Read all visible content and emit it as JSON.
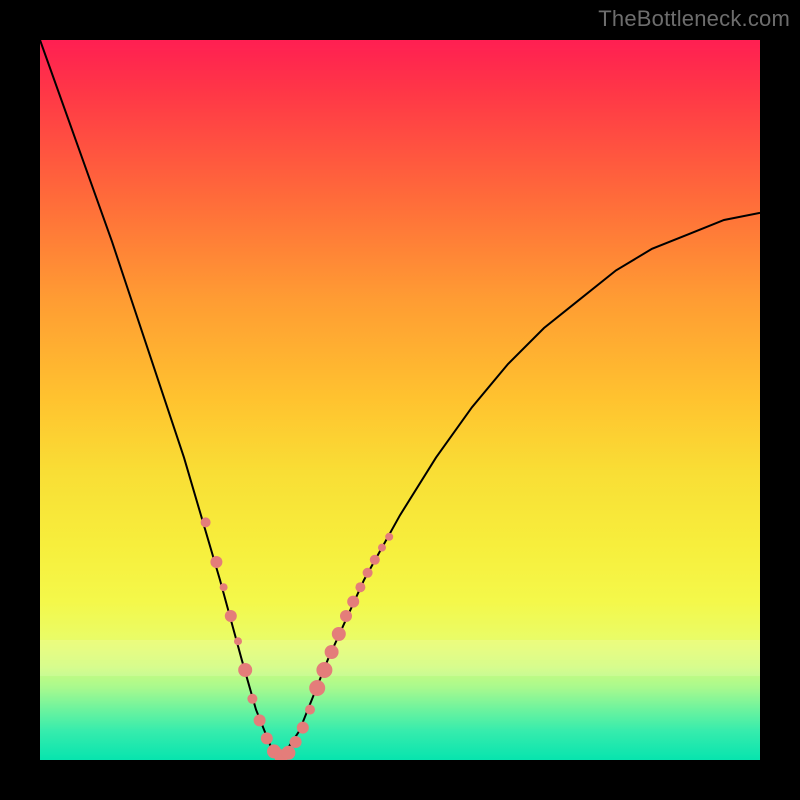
{
  "watermark": "TheBottleneck.com",
  "chart_data": {
    "type": "line",
    "title": "",
    "xlabel": "",
    "ylabel": "",
    "xlim": [
      0,
      100
    ],
    "ylim": [
      0,
      100
    ],
    "grid": false,
    "legend": false,
    "notes": "Background is a vertical gradient from red (top, high bottleneck) through orange/yellow to green (bottom, low bottleneck). Black V-shaped curve reaches minimum ≈0 near x≈33. Salmon markers cluster along the curve near the minimum on both sides.",
    "series": [
      {
        "name": "bottleneck-curve",
        "x": [
          0,
          5,
          10,
          15,
          20,
          25,
          28,
          30,
          32,
          33,
          34,
          36,
          38,
          40,
          45,
          50,
          55,
          60,
          65,
          70,
          75,
          80,
          85,
          90,
          95,
          100
        ],
        "y": [
          100,
          86,
          72,
          57,
          42,
          25,
          14,
          7,
          2,
          0,
          1,
          4,
          9,
          14,
          25,
          34,
          42,
          49,
          55,
          60,
          64,
          68,
          71,
          73,
          75,
          76
        ]
      }
    ],
    "markers": {
      "name": "sample-points",
      "color": "#e47d7a",
      "points": [
        {
          "x": 23.0,
          "y": 33.0,
          "r": 5
        },
        {
          "x": 24.5,
          "y": 27.5,
          "r": 6
        },
        {
          "x": 25.5,
          "y": 24.0,
          "r": 4
        },
        {
          "x": 26.5,
          "y": 20.0,
          "r": 6
        },
        {
          "x": 27.5,
          "y": 16.5,
          "r": 4
        },
        {
          "x": 28.5,
          "y": 12.5,
          "r": 7
        },
        {
          "x": 29.5,
          "y": 8.5,
          "r": 5
        },
        {
          "x": 30.5,
          "y": 5.5,
          "r": 6
        },
        {
          "x": 31.5,
          "y": 3.0,
          "r": 6
        },
        {
          "x": 32.5,
          "y": 1.2,
          "r": 7
        },
        {
          "x": 33.5,
          "y": 0.5,
          "r": 7
        },
        {
          "x": 34.5,
          "y": 1.0,
          "r": 7
        },
        {
          "x": 35.5,
          "y": 2.5,
          "r": 6
        },
        {
          "x": 36.5,
          "y": 4.5,
          "r": 6
        },
        {
          "x": 37.5,
          "y": 7.0,
          "r": 5
        },
        {
          "x": 38.5,
          "y": 10.0,
          "r": 8
        },
        {
          "x": 39.5,
          "y": 12.5,
          "r": 8
        },
        {
          "x": 40.5,
          "y": 15.0,
          "r": 7
        },
        {
          "x": 41.5,
          "y": 17.5,
          "r": 7
        },
        {
          "x": 42.5,
          "y": 20.0,
          "r": 6
        },
        {
          "x": 43.5,
          "y": 22.0,
          "r": 6
        },
        {
          "x": 44.5,
          "y": 24.0,
          "r": 5
        },
        {
          "x": 45.5,
          "y": 26.0,
          "r": 5
        },
        {
          "x": 46.5,
          "y": 27.8,
          "r": 5
        },
        {
          "x": 47.5,
          "y": 29.5,
          "r": 4
        },
        {
          "x": 48.5,
          "y": 31.0,
          "r": 4
        }
      ]
    },
    "gradient_stops": [
      {
        "pos": 0,
        "color": "#ff1f52"
      },
      {
        "pos": 22,
        "color": "#ff6b3a"
      },
      {
        "pos": 50,
        "color": "#ffc32f"
      },
      {
        "pos": 78,
        "color": "#f4f84a"
      },
      {
        "pos": 100,
        "color": "#07e4ae"
      }
    ]
  }
}
